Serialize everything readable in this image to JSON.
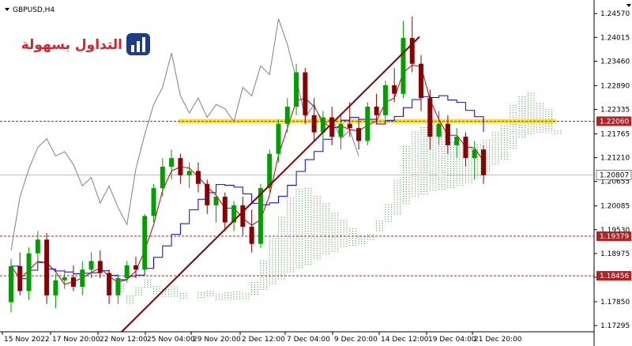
{
  "window": {
    "symbol_title": "GBPUSD,H4",
    "menu_arrow_icon": "triangle-down-icon",
    "corner_arrow_icon": "triangle-down-icon",
    "logo_text": "التداول بسهولة",
    "logo_icon": "bar-chart-icon"
  },
  "colors": {
    "bull": "#00a000",
    "bear": "#8b0000",
    "kijun": "#0000ff",
    "tenkan": "#c00000",
    "chikou": "#808080",
    "cloud_bull": "#2e8b2e",
    "cloud_bear": "#b22222",
    "trendline": "#8b0000",
    "support_line": "#b22222",
    "highlight_band": "#ffd700",
    "tag_bg": "#b22222",
    "tag_text": "#ffffff",
    "current_price_line": "#c0c0c0",
    "logo_red": "#e31e24",
    "logo_blue": "#1f3c88"
  },
  "chart_data": {
    "type": "candlestick",
    "title": "GBPUSD,H4",
    "ylim": [
      1.1715,
      1.2485
    ],
    "y_ticks": [
      "1.24570",
      "1.24015",
      "1.23460",
      "1.22890",
      "1.22335",
      "1.21765",
      "1.21210",
      "1.20655",
      "1.20085",
      "1.19530",
      "1.18975",
      "1.18420",
      "1.17850",
      "1.17295"
    ],
    "x_ticks": [
      "15 Nov 2022",
      "17 Nov 20:00",
      "22 Nov 12:00",
      "25 Nov 04:00",
      "29 Nov 20:00",
      "2 Dec 12:00",
      "7 Dec 04:00",
      "9 Dec 20:00",
      "14 Dec 12:00",
      "19 Dec 04:00",
      "21 Dec 20:00"
    ],
    "candles_approx": [
      [
        1.1784,
        1.1885,
        1.176,
        1.1868
      ],
      [
        1.1868,
        1.19,
        1.18,
        1.181
      ],
      [
        1.181,
        1.1912,
        1.179,
        1.1898
      ],
      [
        1.1898,
        1.195,
        1.187,
        1.193
      ],
      [
        1.193,
        1.1945,
        1.178,
        1.18
      ],
      [
        1.18,
        1.185,
        1.177,
        1.1835
      ],
      [
        1.1835,
        1.186,
        1.1815,
        1.1842
      ],
      [
        1.1842,
        1.187,
        1.181,
        1.182
      ],
      [
        1.182,
        1.188,
        1.18,
        1.186
      ],
      [
        1.186,
        1.19,
        1.184,
        1.188
      ],
      [
        1.188,
        1.1905,
        1.184,
        1.1852
      ],
      [
        1.1852,
        1.186,
        1.178,
        1.18
      ],
      [
        1.18,
        1.185,
        1.178,
        1.184
      ],
      [
        1.184,
        1.188,
        1.183,
        1.187
      ],
      [
        1.187,
        1.189,
        1.184,
        1.186
      ],
      [
        1.186,
        1.199,
        1.185,
        1.1985
      ],
      [
        1.1985,
        1.206,
        1.197,
        1.205
      ],
      [
        1.205,
        1.212,
        1.203,
        1.21
      ],
      [
        1.21,
        1.214,
        1.207,
        1.212
      ],
      [
        1.212,
        1.213,
        1.206,
        1.208
      ],
      [
        1.208,
        1.211,
        1.205,
        1.209
      ],
      [
        1.209,
        1.211,
        1.204,
        1.206
      ],
      [
        1.206,
        1.207,
        1.199,
        1.201
      ],
      [
        1.201,
        1.204,
        1.197,
        1.203
      ],
      [
        1.203,
        1.204,
        1.195,
        1.197
      ],
      [
        1.197,
        1.202,
        1.195,
        1.201
      ],
      [
        1.201,
        1.203,
        1.194,
        1.196
      ],
      [
        1.196,
        1.2,
        1.19,
        1.192
      ],
      [
        1.192,
        1.206,
        1.191,
        1.205
      ],
      [
        1.205,
        1.214,
        1.204,
        1.213
      ],
      [
        1.213,
        1.221,
        1.211,
        1.22
      ],
      [
        1.22,
        1.226,
        1.218,
        1.224
      ],
      [
        1.224,
        1.234,
        1.222,
        1.232
      ],
      [
        1.232,
        1.233,
        1.22,
        1.222
      ],
      [
        1.222,
        1.226,
        1.216,
        1.218
      ],
      [
        1.218,
        1.223,
        1.216,
        1.2215
      ],
      [
        1.2215,
        1.224,
        1.215,
        1.217
      ],
      [
        1.217,
        1.222,
        1.214,
        1.22
      ],
      [
        1.22,
        1.225,
        1.217,
        1.219
      ],
      [
        1.219,
        1.221,
        1.214,
        1.216
      ],
      [
        1.216,
        1.225,
        1.215,
        1.224
      ],
      [
        1.224,
        1.227,
        1.22,
        1.222
      ],
      [
        1.222,
        1.23,
        1.221,
        1.229
      ],
      [
        1.229,
        1.233,
        1.225,
        1.227
      ],
      [
        1.227,
        1.244,
        1.226,
        1.24
      ],
      [
        1.24,
        1.245,
        1.232,
        1.234
      ],
      [
        1.234,
        1.236,
        1.223,
        1.226
      ],
      [
        1.226,
        1.228,
        1.214,
        1.217
      ],
      [
        1.217,
        1.223,
        1.215,
        1.22
      ],
      [
        1.22,
        1.222,
        1.213,
        1.215
      ],
      [
        1.215,
        1.219,
        1.212,
        1.217
      ],
      [
        1.217,
        1.218,
        1.21,
        1.212
      ],
      [
        1.212,
        1.216,
        1.207,
        1.214
      ],
      [
        1.214,
        1.215,
        1.206,
        1.208
      ]
    ],
    "horizontal_levels": [
      1.2206,
      1.19379,
      1.18456
    ],
    "highlight_band": [
      1.2201,
      1.2211
    ],
    "current_price": 1.20807,
    "price_tags": [
      "1.22060",
      "1.20807",
      "1.19379",
      "1.18456"
    ],
    "indicators": [
      "Ichimoku cloud",
      "Tenkan-sen",
      "Kijun-sen",
      "Chikou span"
    ],
    "trendline": {
      "from": [
        1.1715,
        "25 Nov 2022"
      ],
      "to": [
        1.24,
        "14 Dec 2022"
      ]
    }
  }
}
